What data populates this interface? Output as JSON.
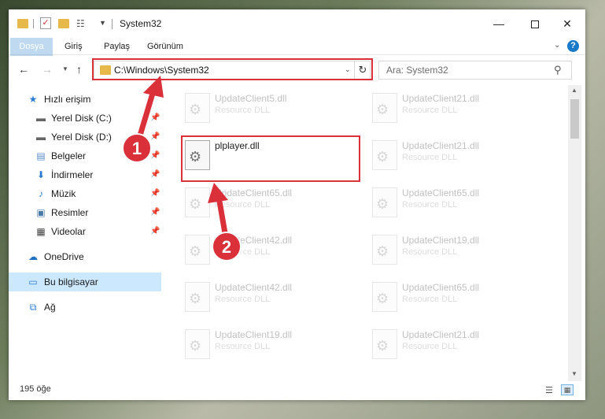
{
  "window": {
    "title": "System32",
    "minimize_glyph": "—",
    "close_glyph": "✕"
  },
  "ribbon": {
    "tabs": [
      "Dosya",
      "Giriş",
      "Paylaş",
      "Görünüm"
    ],
    "help_glyph": "?"
  },
  "navbar": {
    "address": "C:\\Windows\\System32",
    "search_placeholder": "Ara: System32"
  },
  "sidebar": {
    "items": [
      {
        "label": "Hızlı erişim",
        "icon": "star-icon"
      },
      {
        "label": "Yerel Disk (C:)",
        "icon": "drive-icon",
        "pinned": true
      },
      {
        "label": "Yerel Disk (D:)",
        "icon": "drive-icon",
        "pinned": true
      },
      {
        "label": "Belgeler",
        "icon": "documents-icon",
        "pinned": true
      },
      {
        "label": "İndirmeler",
        "icon": "download-icon",
        "pinned": true
      },
      {
        "label": "Müzik",
        "icon": "music-icon",
        "pinned": true
      },
      {
        "label": "Resimler",
        "icon": "pictures-icon",
        "pinned": true
      },
      {
        "label": "Videolar",
        "icon": "videos-icon",
        "pinned": true
      },
      {
        "label": "OneDrive",
        "icon": "cloud-icon"
      },
      {
        "label": "Bu bilgisayar",
        "icon": "computer-icon",
        "selected": true
      },
      {
        "label": "Ağ",
        "icon": "network-icon"
      }
    ]
  },
  "files": [
    {
      "name": "UpdateClient5.dll",
      "desc": "Resource DLL"
    },
    {
      "name": "UpdateClient21.dll",
      "desc": "Resource DLL"
    },
    {
      "name": "plplayer.dll",
      "desc": "",
      "highlighted": true
    },
    {
      "name": "UpdateClient21.dll",
      "desc": "Resource DLL"
    },
    {
      "name": "UpdateClient65.dll",
      "desc": "Resource DLL"
    },
    {
      "name": "UpdateClient65.dll",
      "desc": "Resource DLL"
    },
    {
      "name": "UpdateClient42.dll",
      "desc": "Resource DLL"
    },
    {
      "name": "UpdateClient19.dll",
      "desc": "Resource DLL"
    },
    {
      "name": "UpdateClient42.dll",
      "desc": "Resource DLL"
    },
    {
      "name": "UpdateClient65.dll",
      "desc": "Resource DLL"
    },
    {
      "name": "UpdateClient19.dll",
      "desc": "Resource DLL"
    },
    {
      "name": "UpdateClient21.dll",
      "desc": "Resource DLL"
    }
  ],
  "status": {
    "item_count": "195 öğe"
  },
  "annotations": {
    "step1": "1",
    "step2": "2",
    "color": "#d9303a"
  }
}
